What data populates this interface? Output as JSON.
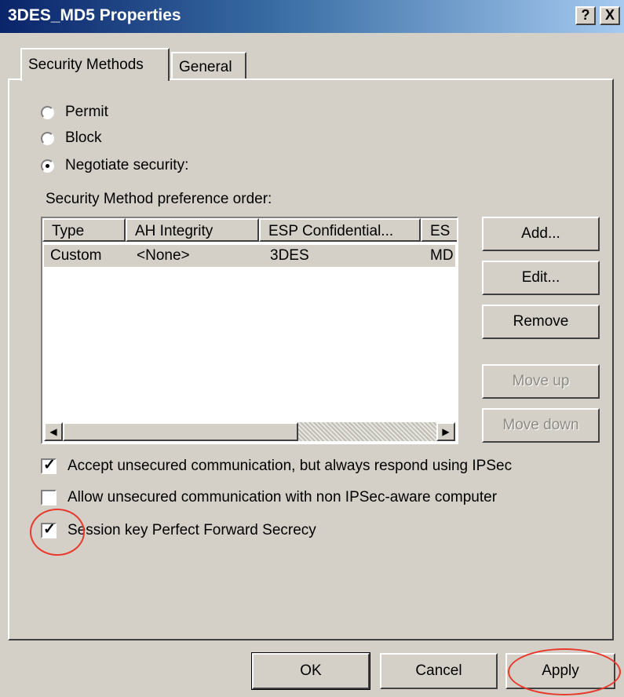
{
  "window": {
    "title": "3DES_MD5 Properties",
    "help_glyph": "?",
    "close_glyph": "X"
  },
  "tabs": [
    {
      "label": "Security Methods",
      "selected": true
    },
    {
      "label": "General",
      "selected": false
    }
  ],
  "action": {
    "options": [
      {
        "label": "Permit",
        "selected": false
      },
      {
        "label": "Block",
        "selected": false
      },
      {
        "label": "Negotiate security:",
        "selected": true
      }
    ]
  },
  "methods": {
    "label": "Security Method preference order:",
    "columns": [
      "Type",
      "AH Integrity",
      "ESP Confidential...",
      "ES"
    ],
    "rows": [
      {
        "type": "Custom",
        "ah_integrity": "<None>",
        "esp_confidentiality": "3DES",
        "esp_integrity": "MD"
      }
    ],
    "scroll_left": "◀",
    "scroll_right": "▶"
  },
  "buttons": {
    "add": "Add...",
    "edit": "Edit...",
    "remove": "Remove",
    "move_up": "Move up",
    "move_down": "Move down"
  },
  "options": [
    {
      "label": "Accept unsecured communication, but always respond using IPSec",
      "checked": true
    },
    {
      "label": "Allow unsecured communication with non IPSec-aware computer",
      "checked": false
    },
    {
      "label": "Session key Perfect Forward Secrecy",
      "checked": true
    }
  ],
  "check_glyph": "✓",
  "footer": {
    "ok": "OK",
    "cancel": "Cancel",
    "apply": "Apply"
  },
  "colors": {
    "titlebar_start": "#0a246a",
    "titlebar_end": "#a6caf0",
    "face": "#d4d0c8",
    "annotation": "#e8392c"
  }
}
